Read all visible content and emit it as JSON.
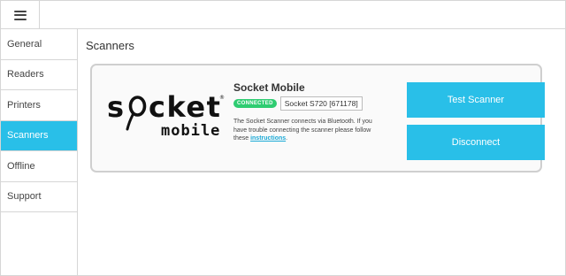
{
  "header": {
    "menu_icon": "hamburger-menu-icon"
  },
  "sidebar": {
    "items": [
      {
        "label": "General"
      },
      {
        "label": "Readers"
      },
      {
        "label": "Printers"
      },
      {
        "label": "Scanners",
        "active": true
      },
      {
        "label": "Offline"
      },
      {
        "label": "Support"
      }
    ]
  },
  "main": {
    "title": "Scanners",
    "card": {
      "logo_alt": "socket mobile",
      "device_name": "Socket Mobile",
      "status": "CONNECTED",
      "model": "Socket S720 [671178]",
      "description": "The Socket Scanner connects via Bluetooth. If you have trouble connecting the scanner please follow these ",
      "link_text": "instructions",
      "description_end": ".",
      "test_button": "Test Scanner",
      "disconnect_button": "Disconnect"
    }
  },
  "colors": {
    "accent": "#29bfe8",
    "connected": "#2ecc71",
    "link": "#1ba9d6"
  }
}
